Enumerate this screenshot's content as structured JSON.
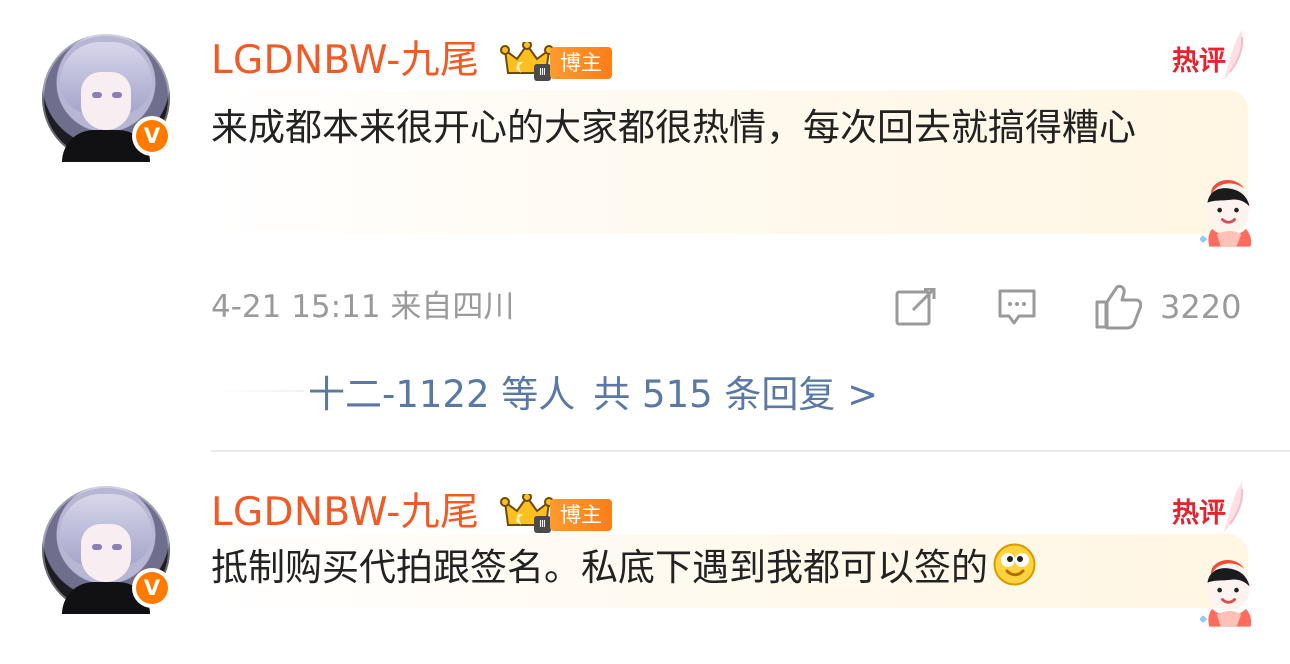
{
  "comments": [
    {
      "username": "LGDNBW-九尾",
      "badge": "博主",
      "crown_level": "Ⅲ",
      "hot_label": "热评",
      "content": "来成都本来很开心的大家都很热情，每次回去就搞得糟心",
      "meta": "4-21 15:11 来自四川",
      "like_count": "3220",
      "reply_summary": {
        "users": "十二-1122 等人",
        "replies": "共 515 条回复 >"
      }
    },
    {
      "username": "LGDNBW-九尾",
      "badge": "博主",
      "crown_level": "Ⅲ",
      "hot_label": "热评",
      "content": "抵制购买代拍跟签名。私底下遇到我都可以签的"
    }
  ],
  "icons": {
    "verify": "V",
    "share": "share-icon",
    "reply": "comment-icon",
    "like": "like-icon",
    "emoji": "smiling-face-icon",
    "sticker": "cartoon-sticker-icon"
  },
  "colors": {
    "username": "#f05a24",
    "badge": "#ff8a24",
    "hot": "#e6222f",
    "text": "#222222",
    "meta": "#9a9a9a",
    "link": "#5a78a6",
    "divider": "#e9e9e9"
  }
}
